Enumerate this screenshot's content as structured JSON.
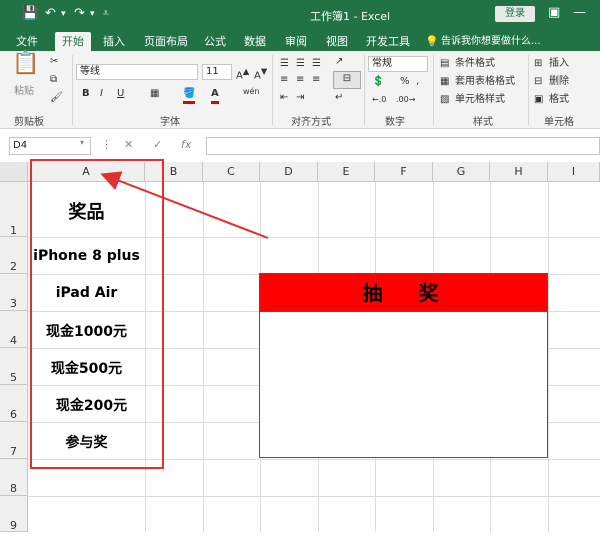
{
  "title_bar": {
    "title": "工作簿1 - Excel",
    "login": "登录"
  },
  "tabs": [
    "文件",
    "开始",
    "插入",
    "页面布局",
    "公式",
    "数据",
    "审阅",
    "视图",
    "开发工具",
    "告诉我你想要做什么..."
  ],
  "ribbon": {
    "paste": "粘贴",
    "clipboard": "剪贴板",
    "font_name": "等线",
    "font_size": "11",
    "font_group": "字体",
    "align_group": "对齐方式",
    "number_format": "常规",
    "number_group": "数字",
    "conditional": "条件格式",
    "table_format": "套用表格格式",
    "cell_style": "单元格样式",
    "style_group": "样式",
    "insert": "插入",
    "delete": "删除",
    "format": "格式",
    "cells_group": "单元格"
  },
  "formula_bar": {
    "name_box": "D4",
    "fx": "fx",
    "content": ""
  },
  "columns": [
    "A",
    "B",
    "C",
    "D",
    "E",
    "F",
    "G",
    "H",
    "I"
  ],
  "rows": [
    "1",
    "2",
    "3",
    "4",
    "5",
    "6",
    "7",
    "8",
    "9"
  ],
  "column_a": [
    "奖品",
    "iPhone 8 plus",
    "iPad Air",
    "现金1000元",
    "现金500元",
    "现金200元",
    "参与奖"
  ],
  "lottery_title": "抽奖"
}
